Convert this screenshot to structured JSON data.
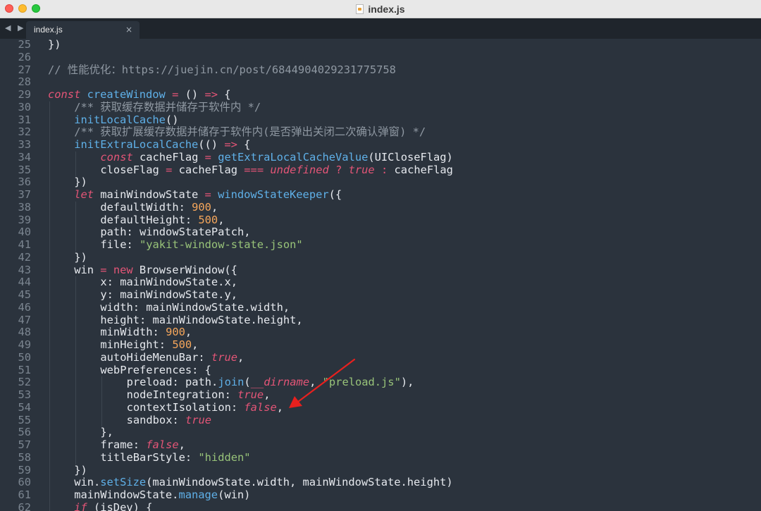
{
  "window": {
    "title": "index.js"
  },
  "tabs": [
    {
      "label": "index.js",
      "close": "×"
    }
  ],
  "nav": {
    "label": "◀ ▶"
  },
  "lines": [
    {
      "n": "25",
      "i": 0,
      "t": [
        [
          "p",
          "})"
        ]
      ]
    },
    {
      "n": "26",
      "i": 0,
      "t": []
    },
    {
      "n": "27",
      "i": 0,
      "t": [
        [
          "c",
          "// 性能优化：https://juejin.cn/post/6844904029231775758"
        ]
      ]
    },
    {
      "n": "28",
      "i": 0,
      "t": []
    },
    {
      "n": "29",
      "i": 0,
      "t": [
        [
          "k",
          "const"
        ],
        [
          "p",
          " "
        ],
        [
          "f",
          "createWindow"
        ],
        [
          "p",
          " "
        ],
        [
          "o",
          "="
        ],
        [
          "p",
          " () "
        ],
        [
          "o",
          "=>"
        ],
        [
          "p",
          " {"
        ]
      ]
    },
    {
      "n": "30",
      "i": 1,
      "t": [
        [
          "c",
          "/** 获取缓存数据并储存于软件内 */"
        ]
      ]
    },
    {
      "n": "31",
      "i": 1,
      "t": [
        [
          "f",
          "initLocalCache"
        ],
        [
          "p",
          "()"
        ]
      ]
    },
    {
      "n": "32",
      "i": 1,
      "t": [
        [
          "c",
          "/** 获取扩展缓存数据并储存于软件内(是否弹出关闭二次确认弹窗) */"
        ]
      ]
    },
    {
      "n": "33",
      "i": 1,
      "t": [
        [
          "f",
          "initExtraLocalCache"
        ],
        [
          "p",
          "(() "
        ],
        [
          "o",
          "=>"
        ],
        [
          "p",
          " {"
        ]
      ]
    },
    {
      "n": "34",
      "i": 2,
      "t": [
        [
          "k",
          "const"
        ],
        [
          "p",
          " cacheFlag "
        ],
        [
          "o",
          "="
        ],
        [
          "p",
          " "
        ],
        [
          "f",
          "getExtraLocalCacheValue"
        ],
        [
          "p",
          "(UICloseFlag)"
        ]
      ]
    },
    {
      "n": "35",
      "i": 2,
      "t": [
        [
          "p",
          "closeFlag "
        ],
        [
          "o",
          "="
        ],
        [
          "p",
          " cacheFlag "
        ],
        [
          "o",
          "==="
        ],
        [
          "p",
          " "
        ],
        [
          "b",
          "undefined"
        ],
        [
          "p",
          " "
        ],
        [
          "o",
          "?"
        ],
        [
          "p",
          " "
        ],
        [
          "b",
          "true"
        ],
        [
          "p",
          " "
        ],
        [
          "o",
          ":"
        ],
        [
          "p",
          " cacheFlag"
        ]
      ]
    },
    {
      "n": "36",
      "i": 1,
      "t": [
        [
          "p",
          "})"
        ]
      ]
    },
    {
      "n": "37",
      "i": 1,
      "t": [
        [
          "k",
          "let"
        ],
        [
          "p",
          " mainWindowState "
        ],
        [
          "o",
          "="
        ],
        [
          "p",
          " "
        ],
        [
          "f",
          "windowStateKeeper"
        ],
        [
          "p",
          "({"
        ]
      ]
    },
    {
      "n": "38",
      "i": 2,
      "t": [
        [
          "p",
          "defaultWidth: "
        ],
        [
          "n",
          "900"
        ],
        [
          "p",
          ","
        ]
      ]
    },
    {
      "n": "39",
      "i": 2,
      "t": [
        [
          "p",
          "defaultHeight: "
        ],
        [
          "n",
          "500"
        ],
        [
          "p",
          ","
        ]
      ]
    },
    {
      "n": "40",
      "i": 2,
      "t": [
        [
          "p",
          "path: windowStatePatch,"
        ]
      ]
    },
    {
      "n": "41",
      "i": 2,
      "t": [
        [
          "p",
          "file: "
        ],
        [
          "s",
          "\"yakit-window-state.json\""
        ]
      ]
    },
    {
      "n": "42",
      "i": 1,
      "t": [
        [
          "p",
          "})"
        ]
      ]
    },
    {
      "n": "43",
      "i": 1,
      "t": [
        [
          "p",
          "win "
        ],
        [
          "o",
          "="
        ],
        [
          "p",
          " "
        ],
        [
          "o",
          "new"
        ],
        [
          "p",
          " BrowserWindow({"
        ]
      ]
    },
    {
      "n": "44",
      "i": 2,
      "t": [
        [
          "p",
          "x: mainWindowState.x,"
        ]
      ]
    },
    {
      "n": "45",
      "i": 2,
      "t": [
        [
          "p",
          "y: mainWindowState.y,"
        ]
      ]
    },
    {
      "n": "46",
      "i": 2,
      "t": [
        [
          "p",
          "width: mainWindowState.width,"
        ]
      ]
    },
    {
      "n": "47",
      "i": 2,
      "t": [
        [
          "p",
          "height: mainWindowState.height,"
        ]
      ]
    },
    {
      "n": "48",
      "i": 2,
      "t": [
        [
          "p",
          "minWidth: "
        ],
        [
          "n",
          "900"
        ],
        [
          "p",
          ","
        ]
      ]
    },
    {
      "n": "49",
      "i": 2,
      "t": [
        [
          "p",
          "minHeight: "
        ],
        [
          "n",
          "500"
        ],
        [
          "p",
          ","
        ]
      ]
    },
    {
      "n": "50",
      "i": 2,
      "t": [
        [
          "p",
          "autoHideMenuBar: "
        ],
        [
          "b",
          "true"
        ],
        [
          "p",
          ","
        ]
      ]
    },
    {
      "n": "51",
      "i": 2,
      "t": [
        [
          "p",
          "webPreferences: {"
        ]
      ]
    },
    {
      "n": "52",
      "i": 3,
      "t": [
        [
          "p",
          "preload: path."
        ],
        [
          "f",
          "join"
        ],
        [
          "p",
          "("
        ],
        [
          "b",
          "__dirname"
        ],
        [
          "p",
          ", "
        ],
        [
          "s",
          "\"preload.js\""
        ],
        [
          "p",
          "),"
        ]
      ]
    },
    {
      "n": "53",
      "i": 3,
      "t": [
        [
          "p",
          "nodeIntegration: "
        ],
        [
          "b",
          "true"
        ],
        [
          "p",
          ","
        ]
      ]
    },
    {
      "n": "54",
      "i": 3,
      "t": [
        [
          "p",
          "contextIsolation: "
        ],
        [
          "b",
          "false"
        ],
        [
          "p",
          ","
        ]
      ]
    },
    {
      "n": "55",
      "i": 3,
      "t": [
        [
          "p",
          "sandbox: "
        ],
        [
          "b",
          "true"
        ]
      ]
    },
    {
      "n": "56",
      "i": 2,
      "t": [
        [
          "p",
          "},"
        ]
      ]
    },
    {
      "n": "57",
      "i": 2,
      "t": [
        [
          "p",
          "frame: "
        ],
        [
          "b",
          "false"
        ],
        [
          "p",
          ","
        ]
      ]
    },
    {
      "n": "58",
      "i": 2,
      "t": [
        [
          "p",
          "titleBarStyle: "
        ],
        [
          "s",
          "\"hidden\""
        ]
      ]
    },
    {
      "n": "59",
      "i": 1,
      "t": [
        [
          "p",
          "})"
        ]
      ]
    },
    {
      "n": "60",
      "i": 1,
      "t": [
        [
          "p",
          "win."
        ],
        [
          "f",
          "setSize"
        ],
        [
          "p",
          "(mainWindowState.width, mainWindowState.height)"
        ]
      ]
    },
    {
      "n": "61",
      "i": 1,
      "t": [
        [
          "p",
          "mainWindowState."
        ],
        [
          "f",
          "manage"
        ],
        [
          "p",
          "(win)"
        ]
      ]
    },
    {
      "n": "62",
      "i": 1,
      "t": [
        [
          "k",
          "if"
        ],
        [
          "p",
          " (isDev) {"
        ]
      ]
    }
  ],
  "colors": {
    "background": "#2b333d",
    "keyword": "#e45577",
    "function": "#5fb0e8",
    "number": "#f5a65b",
    "string": "#98c379",
    "comment": "#8f98a2",
    "annotation_arrow": "#e8201e"
  }
}
